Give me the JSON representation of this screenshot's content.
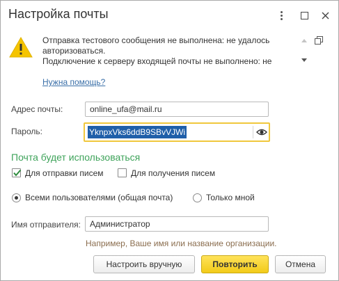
{
  "window": {
    "title": "Настройка почты"
  },
  "messages": {
    "lines": [
      "Отправка тестового сообщения не выполнена: не удалось",
      "авторизоваться.",
      "Подключение к серверу входящей почты не выполнено: не"
    ]
  },
  "help": {
    "link_label": "Нужна помощь?"
  },
  "form": {
    "email_label": "Адрес почты:",
    "email_value": "online_ufa@mail.ru",
    "password_label": "Пароль:",
    "password_value": "YknpxVks6ddB9SBvVJWi",
    "section_title": "Почта будет использоваться",
    "send_label": "Для отправки писем",
    "send_checked": true,
    "receive_label": "Для получения писем",
    "receive_checked": false,
    "all_users_label": "Всеми пользователями (общая почта)",
    "only_me_label": "Только мной",
    "selected_usage": "all_users",
    "sender_label": "Имя отправителя:",
    "sender_value": "Администратор",
    "sender_hint": "Например, Ваше имя или название организации."
  },
  "buttons": {
    "manual": "Настроить вручную",
    "retry": "Повторить",
    "cancel": "Отмена"
  },
  "colors": {
    "section_title": "#3ea35a",
    "hint": "#8a6d4e",
    "link": "#3a6fa8",
    "primary_button": "#f2cb19",
    "password_focus_border": "#f0c73c",
    "selection": "#1f5fa9",
    "warning": "#f5c400"
  },
  "icons": {
    "warning": "warning-triangle-icon",
    "more": "more-vertical-icon",
    "maximize": "maximize-icon",
    "close": "close-icon",
    "show_password": "eye-icon",
    "open_in_window": "open-window-icon"
  }
}
